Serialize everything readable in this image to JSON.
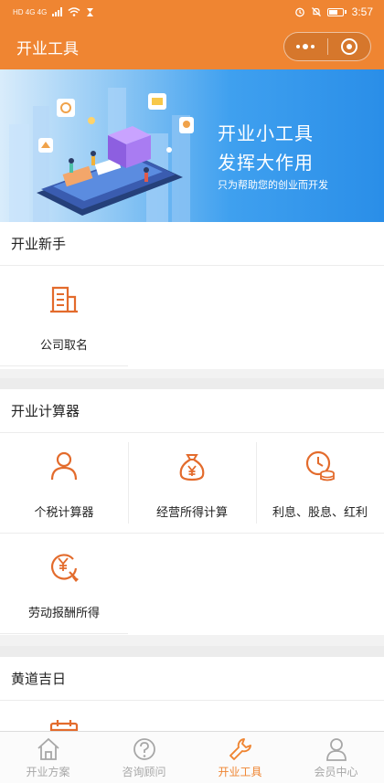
{
  "status_bar": {
    "left": "HD 4G 4G",
    "time": "3:57"
  },
  "header": {
    "title": "开业工具"
  },
  "banner": {
    "title_line1": "开业小工具",
    "title_line2": "发挥大作用",
    "subtitle": "只为帮助您的创业而开发"
  },
  "sections": [
    {
      "title": "开业新手",
      "items": [
        {
          "label": "公司取名",
          "icon": "company-building-icon"
        }
      ]
    },
    {
      "title": "开业计算器",
      "items": [
        {
          "label": "个税计算器",
          "icon": "person-icon"
        },
        {
          "label": "经营所得计算",
          "icon": "money-bag-icon"
        },
        {
          "label": "利息、股息、红利",
          "icon": "clock-coins-icon"
        },
        {
          "label": "劳动报酬所得",
          "icon": "yen-shovel-icon"
        }
      ]
    },
    {
      "title": "黄道吉日",
      "items": [
        {
          "label": "",
          "icon": "calendar-icon"
        }
      ]
    }
  ],
  "tabbar": [
    {
      "label": "开业方案",
      "icon": "house-icon",
      "active": false
    },
    {
      "label": "咨询顾问",
      "icon": "question-icon",
      "active": false
    },
    {
      "label": "开业工具",
      "icon": "wrench-icon",
      "active": true
    },
    {
      "label": "会员中心",
      "icon": "user-icon",
      "active": false
    }
  ],
  "colors": {
    "accent": "#ef8532",
    "icon": "#e36b2c",
    "inactive": "#a7a7a7"
  }
}
